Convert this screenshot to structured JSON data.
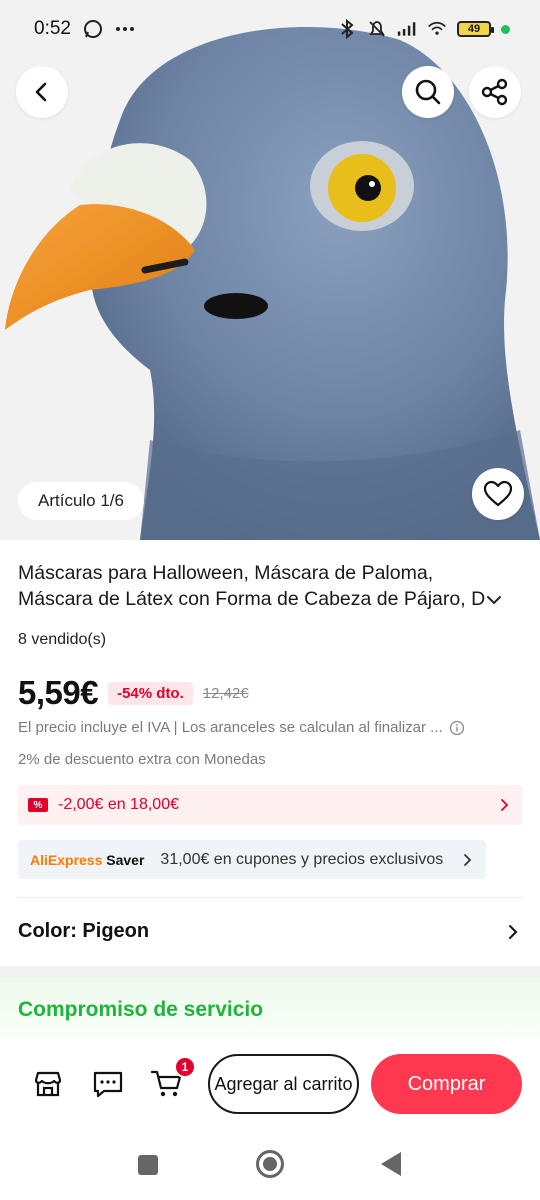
{
  "status_bar": {
    "time": "0:52",
    "battery": "49"
  },
  "gallery": {
    "counter": "Artículo 1/6"
  },
  "product": {
    "title_line1": "Máscaras para Halloween, Máscara de Paloma,",
    "title_line2": "Máscara de Látex con Forma de Cabeza de Pájaro, D",
    "sold": "8 vendido(s)",
    "price": "5,59€",
    "discount": "-54% dto.",
    "old_price": "12,42€",
    "tax_note": "El precio incluye el IVA | Los aranceles se calculan al finalizar ...",
    "coins_note": "2% de descuento extra con Monedas",
    "coupon": "-2,00€ en 18,00€",
    "saver_logo_a": "AliExpress",
    "saver_logo_b": "Saver",
    "saver_text": "31,00€ en cupones y precios exclusivos",
    "color_label": "Color: Pigeon",
    "service_title": "Compromiso de servicio"
  },
  "actions": {
    "cart_count": "1",
    "add_to_cart": "Agregar al carrito",
    "buy": "Comprar"
  },
  "colors": {
    "accent": "#e1002c",
    "buy_button": "#fd384f",
    "service_green": "#22b33a"
  },
  "icons": [
    "back-arrow-icon",
    "search-icon",
    "share-icon",
    "heart-icon",
    "info-icon",
    "coupon-icon",
    "chevron-right-icon",
    "store-icon",
    "chat-icon",
    "cart-icon"
  ]
}
